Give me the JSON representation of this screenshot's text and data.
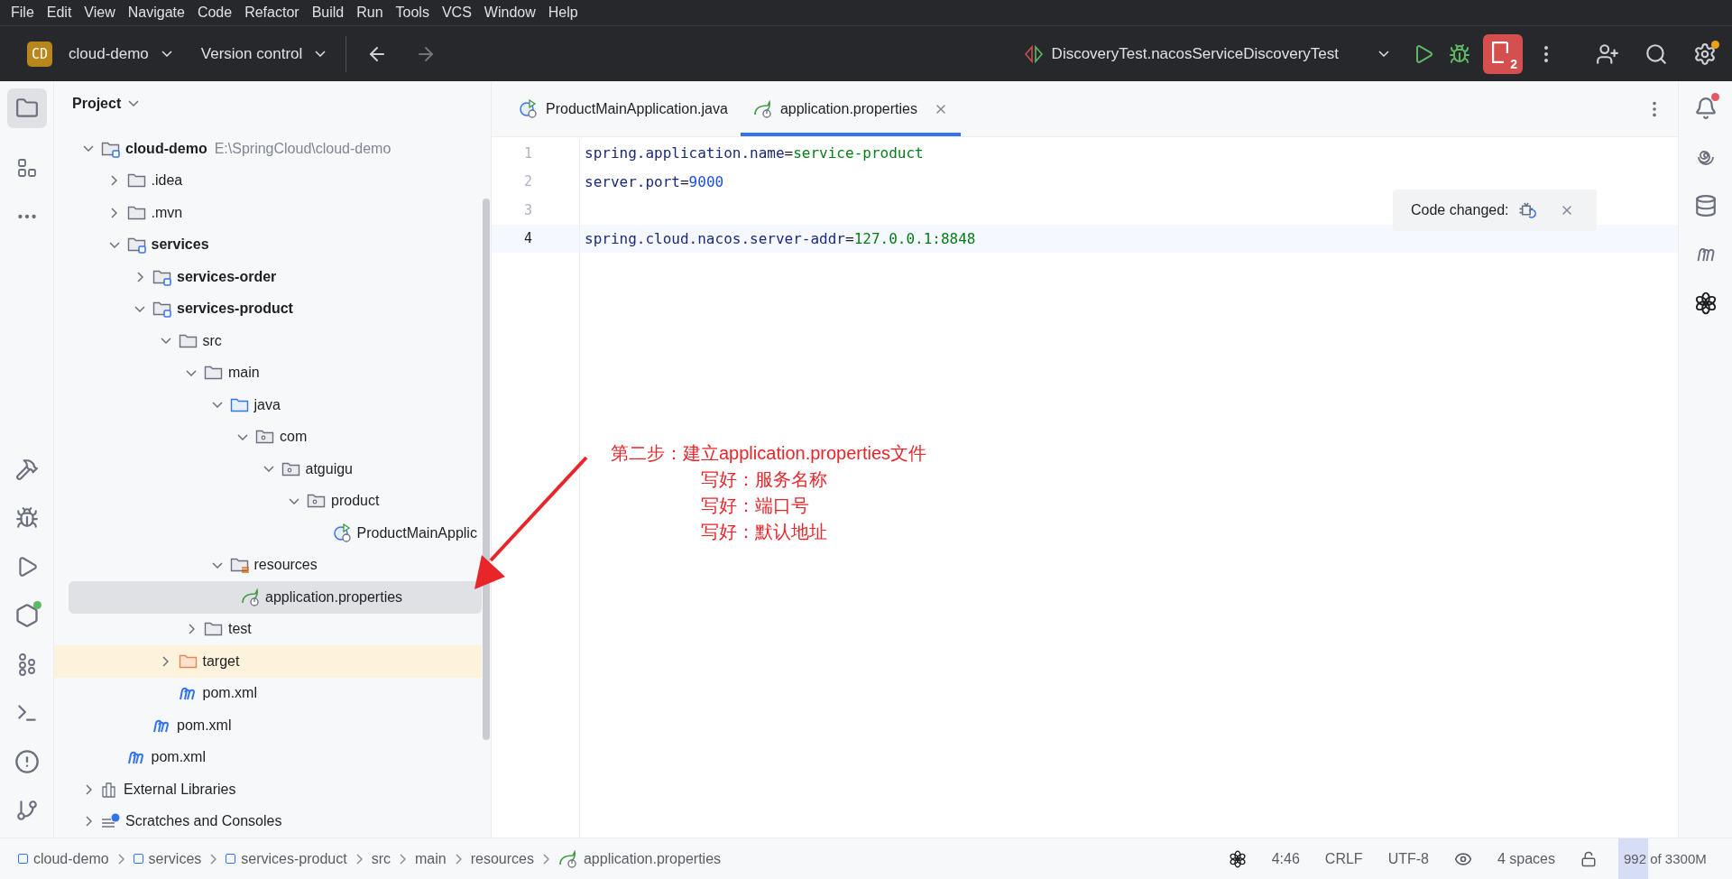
{
  "menu_bar": [
    "File",
    "Edit",
    "View",
    "Navigate",
    "Code",
    "Refactor",
    "Build",
    "Run",
    "Tools",
    "VCS",
    "Window",
    "Help"
  ],
  "toolbar": {
    "project_badge": "CD",
    "project": "cloud-demo",
    "vcs": "Version control",
    "run_config": "DiscoveryTest.nacosServiceDiscoveryTest",
    "process_count": "2"
  },
  "project_panel": {
    "title": "Project",
    "tree": [
      {
        "label": "cloud-demo",
        "kind": "module",
        "hint": "E:\\SpringCloud\\cloud-demo",
        "expanded": true,
        "selected": false,
        "children": [
          {
            "label": ".idea",
            "kind": "folder",
            "expanded": false,
            "selected": false
          },
          {
            "label": ".mvn",
            "kind": "folder",
            "expanded": false,
            "selected": false
          },
          {
            "label": "services",
            "kind": "module",
            "expanded": true,
            "selected": false,
            "children": [
              {
                "label": "services-order",
                "kind": "module",
                "expanded": false,
                "selected": false
              },
              {
                "label": "services-product",
                "kind": "module",
                "expanded": true,
                "selected": false,
                "children": [
                  {
                    "label": "src",
                    "kind": "folder",
                    "expanded": true,
                    "selected": false,
                    "children": [
                      {
                        "label": "main",
                        "kind": "folder",
                        "expanded": true,
                        "selected": false,
                        "children": [
                          {
                            "label": "java",
                            "kind": "source",
                            "expanded": true,
                            "selected": false,
                            "children": [
                              {
                                "label": "com",
                                "kind": "package",
                                "expanded": true,
                                "selected": false,
                                "children": [
                                  {
                                    "label": "atguigu",
                                    "kind": "package",
                                    "expanded": true,
                                    "selected": false,
                                    "children": [
                                      {
                                        "label": "product",
                                        "kind": "package",
                                        "expanded": true,
                                        "selected": false,
                                        "children": [
                                          {
                                            "label": "ProductMainApplic",
                                            "kind": "java-class",
                                            "selected": false
                                          }
                                        ]
                                      }
                                    ]
                                  }
                                ]
                              }
                            ]
                          },
                          {
                            "label": "resources",
                            "kind": "resources",
                            "expanded": true,
                            "selected": false,
                            "children": [
                              {
                                "label": "application.properties",
                                "kind": "spring",
                                "selected": true
                              }
                            ]
                          }
                        ]
                      },
                      {
                        "label": "test",
                        "kind": "folder",
                        "expanded": false,
                        "selected": false
                      }
                    ]
                  },
                  {
                    "label": "target",
                    "kind": "excluded",
                    "expanded": false,
                    "selected": false
                  },
                  {
                    "label": "pom.xml",
                    "kind": "maven",
                    "selected": false
                  }
                ]
              },
              {
                "label": "pom.xml",
                "kind": "maven",
                "selected": false
              }
            ]
          },
          {
            "label": "pom.xml",
            "kind": "maven",
            "selected": false
          }
        ]
      },
      {
        "label": "External Libraries",
        "kind": "libraries",
        "expanded": false,
        "selected": false
      },
      {
        "label": "Scratches and Consoles",
        "kind": "scratches",
        "expanded": false,
        "selected": false
      }
    ]
  },
  "editor": {
    "tabs": [
      {
        "label": "ProductMainApplication.java",
        "kind": "java-class",
        "selected": false
      },
      {
        "label": "application.properties",
        "kind": "spring",
        "selected": true
      }
    ],
    "lines": [
      {
        "number": "1",
        "current": false,
        "tokens": [
          {
            "kind": "key",
            "text": "spring.application.name"
          },
          {
            "kind": "op",
            "text": "="
          },
          {
            "kind": "string",
            "text": "service-product"
          }
        ]
      },
      {
        "number": "2",
        "current": false,
        "tokens": [
          {
            "kind": "key",
            "text": "server.port"
          },
          {
            "kind": "op",
            "text": "="
          },
          {
            "kind": "number",
            "text": "9000"
          }
        ]
      },
      {
        "number": "3",
        "current": false
      },
      {
        "number": "4",
        "current": true,
        "tokens": [
          {
            "kind": "key",
            "text": "spring.cloud.nacos.server-addr"
          },
          {
            "kind": "op",
            "text": "="
          },
          {
            "kind": "string",
            "text": "127.0.0.1:8848"
          }
        ]
      }
    ],
    "popup": {
      "text": "Code changed:"
    },
    "annotation": {
      "title": "第二步：建立application.properties文件",
      "items": [
        "写好：服务名称",
        "写好：端口号",
        "写好：默认地址"
      ]
    }
  },
  "status_bar": {
    "breadcrumbs": [
      {
        "label": "cloud-demo",
        "kind": "module"
      },
      {
        "label": "services",
        "kind": "module"
      },
      {
        "label": "services-product",
        "kind": "module"
      },
      {
        "label": "src",
        "kind": "plain"
      },
      {
        "label": "main",
        "kind": "plain"
      },
      {
        "label": "resources",
        "kind": "plain"
      },
      {
        "label": "application.properties",
        "kind": "spring"
      }
    ],
    "position": "4:46",
    "line_ending": "CRLF",
    "encoding": "UTF-8",
    "indent": "4 spaces",
    "memory": {
      "text": "992 of 3300M",
      "level": 0.3
    }
  }
}
